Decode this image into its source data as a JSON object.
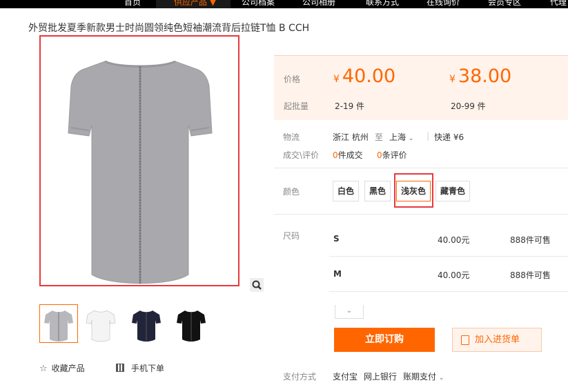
{
  "nav": {
    "items": [
      {
        "label": "首页"
      },
      {
        "label": "供应产品 ▼"
      },
      {
        "label": "公司档案"
      },
      {
        "label": "公司相册"
      },
      {
        "label": "联系方式"
      },
      {
        "label": "在线询价"
      },
      {
        "label": "会员专区"
      },
      {
        "label": "代理"
      }
    ]
  },
  "product": {
    "title": "外贸批发夏季新款男士时尚圆领纯色短袖潮流背后拉链T恤 B CCH"
  },
  "gallery": {
    "thumbs": [
      {
        "color": "#b8b8bc"
      },
      {
        "color": "#f4f4f4"
      },
      {
        "color": "#22243a"
      },
      {
        "color": "#111111"
      }
    ]
  },
  "actions": {
    "favorite": "收藏产品",
    "mobile": "手机下单"
  },
  "pricing": {
    "price_label": "价格",
    "min_label": "起批量",
    "currency": "¥",
    "tiers": [
      {
        "price": "40.00",
        "qty": "2-19 件"
      },
      {
        "price": "38.00",
        "qty": "20-99 件"
      }
    ]
  },
  "logistics": {
    "label": "物流",
    "from": "浙江 杭州",
    "to_word": "至",
    "to": "上海",
    "shipping": "快递 ¥6"
  },
  "deals": {
    "label": "成交\\评价",
    "count": "0",
    "count_suffix": "件成交",
    "reviews": "0",
    "reviews_suffix": "条评价"
  },
  "colors": {
    "label": "颜色",
    "options": [
      "白色",
      "黑色",
      "浅灰色",
      "藏青色"
    ],
    "selected": "浅灰色"
  },
  "sizes": {
    "label": "尺码",
    "rows": [
      {
        "name": "S",
        "price": "40.00元",
        "stock": "888件可售"
      },
      {
        "name": "M",
        "price": "40.00元",
        "stock": "888件可售"
      }
    ]
  },
  "buttons": {
    "order": "立即订购",
    "cart": "加入进货单"
  },
  "payment": {
    "label": "支付方式",
    "methods": [
      "支付宝",
      "网上银行",
      "账期支付"
    ]
  },
  "brand": {
    "accent": "#ff6600",
    "highlight": "#e8393c",
    "shirt": "#a9a9ad"
  }
}
